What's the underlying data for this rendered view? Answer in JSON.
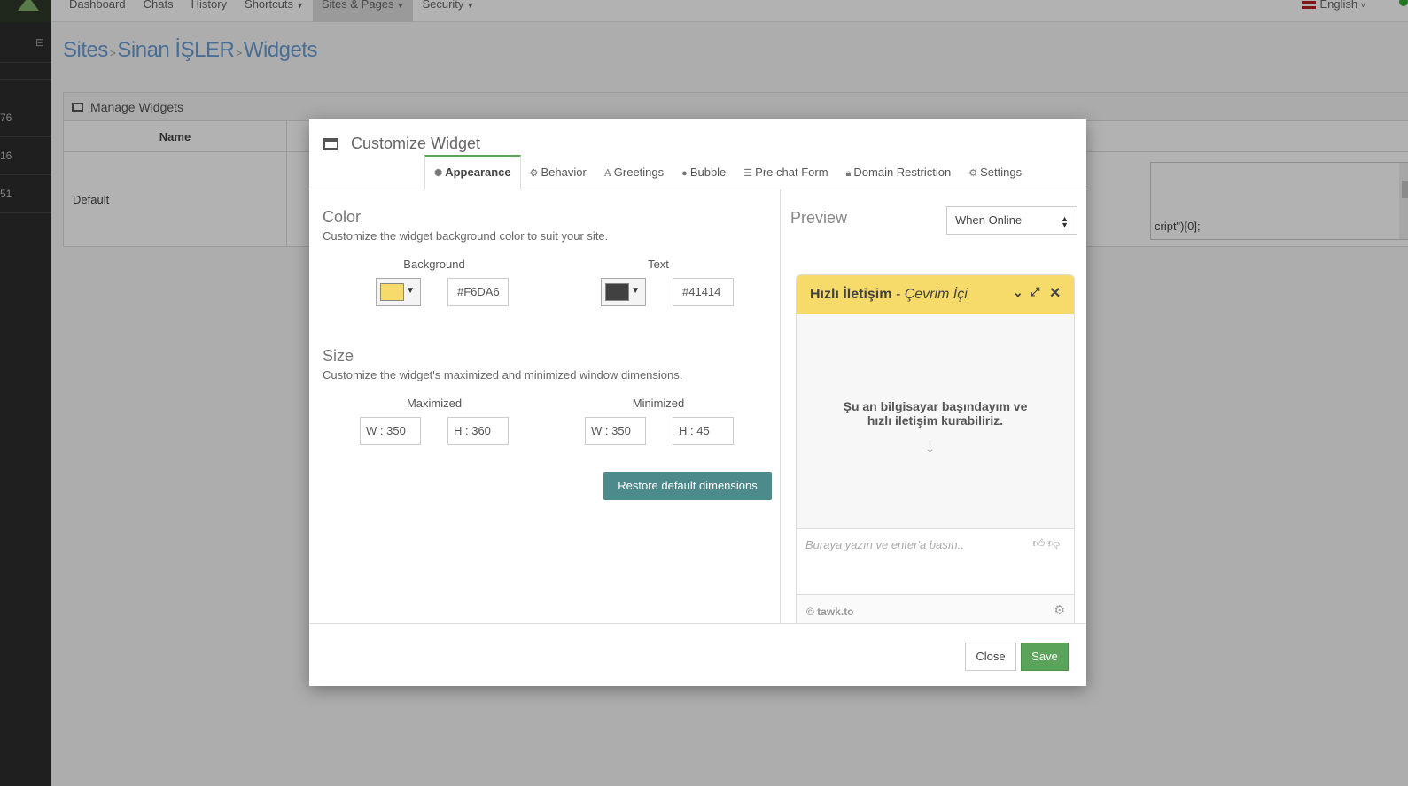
{
  "topnav": {
    "items": [
      {
        "label": "Dashboard",
        "dropdown": false
      },
      {
        "label": "Chats",
        "dropdown": false
      },
      {
        "label": "History",
        "dropdown": false
      },
      {
        "label": "Shortcuts",
        "dropdown": true
      },
      {
        "label": "Sites & Pages",
        "dropdown": true,
        "active": true
      },
      {
        "label": "Security",
        "dropdown": true
      }
    ],
    "language": "English"
  },
  "sidebar": {
    "rows": [
      "76",
      "16",
      "51"
    ]
  },
  "breadcrumb": {
    "items": [
      "Sites",
      "Sinan İŞLER",
      "Widgets"
    ]
  },
  "panel": {
    "title": "Manage Widgets",
    "column_name": "Name",
    "row_name": "Default",
    "code_snippet": "cript\")[0];"
  },
  "modal": {
    "title": "Customize Widget",
    "tabs": [
      {
        "label": "Appearance",
        "icon": "gear-outline-icon",
        "active": true
      },
      {
        "label": "Behavior",
        "icon": "cogs-icon"
      },
      {
        "label": "Greetings",
        "icon": "font-icon"
      },
      {
        "label": "Bubble",
        "icon": "comment-icon"
      },
      {
        "label": "Pre chat Form",
        "icon": "list-icon"
      },
      {
        "label": "Domain Restriction",
        "icon": "lock-icon"
      },
      {
        "label": "Settings",
        "icon": "gear-icon"
      }
    ],
    "color": {
      "title": "Color",
      "description": "Customize the widget background color to suit your site.",
      "background_label": "Background",
      "background_value": "#F6DA6",
      "background_swatch": "#F6DA6A",
      "text_label": "Text",
      "text_value": "#41414",
      "text_swatch": "#414141"
    },
    "size": {
      "title": "Size",
      "description": "Customize the widget's maximized and minimized window dimensions.",
      "maximized_label": "Maximized",
      "minimized_label": "Minimized",
      "max_w": "W :  350",
      "max_h": "H :  360",
      "min_w": "W :  350",
      "min_h": "H :  45",
      "restore_label": "Restore default dimensions"
    },
    "preview": {
      "title": "Preview",
      "mode": "When Online",
      "widget": {
        "name": "Hızlı İletişim",
        "status": "- Çevrim İçi",
        "message_line1": "Şu an bilgisayar başındayım ve",
        "message_line2": "hızlı iletişim kurabiliriz.",
        "input_placeholder": "Buraya yazın ve enter'a basın..",
        "brand": "© tawk.to"
      }
    },
    "footer": {
      "close_label": "Close",
      "save_label": "Save"
    }
  }
}
